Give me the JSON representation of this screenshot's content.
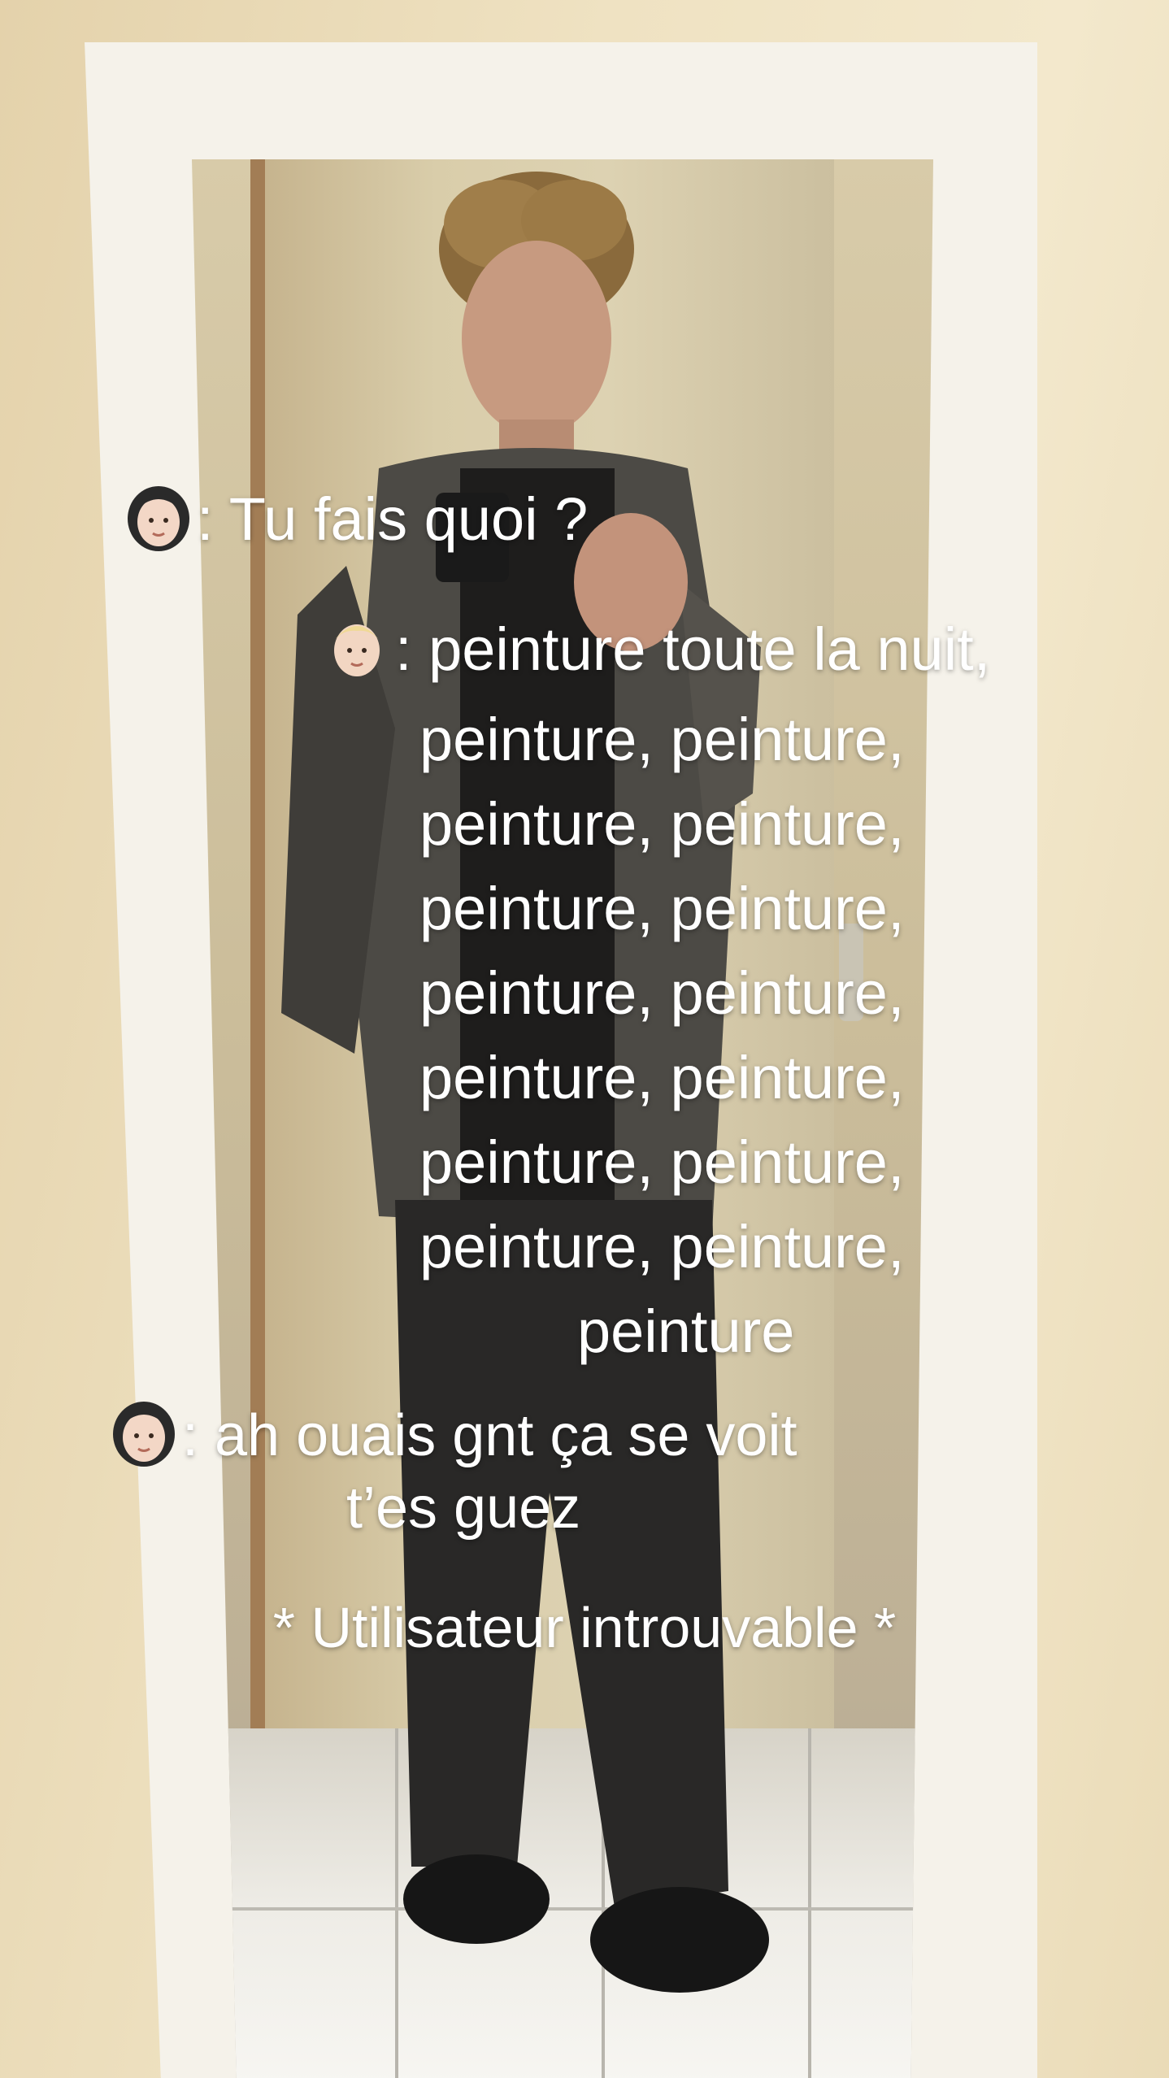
{
  "photo": {
    "description_icons": [
      "woman-emoji-icon",
      "blond-man-emoji-icon"
    ]
  },
  "messages": [
    {
      "speaker_icon": "woman-emoji-icon",
      "lines": [
        ": Tu fais quoi ?"
      ]
    },
    {
      "speaker_icon": "blond-man-emoji-icon",
      "lines": [
        ": peinture toute la nuit,",
        "peinture, peinture,",
        "peinture, peinture,",
        "peinture, peinture,",
        "peinture, peinture,",
        "peinture, peinture,",
        "peinture, peinture,",
        "peinture, peinture,",
        "peinture"
      ]
    },
    {
      "speaker_icon": "woman-emoji-icon",
      "lines": [
        ": ah ouais gnt ça se voit",
        "t’es guez"
      ]
    }
  ],
  "system_message": "* Utilisateur introuvable *"
}
